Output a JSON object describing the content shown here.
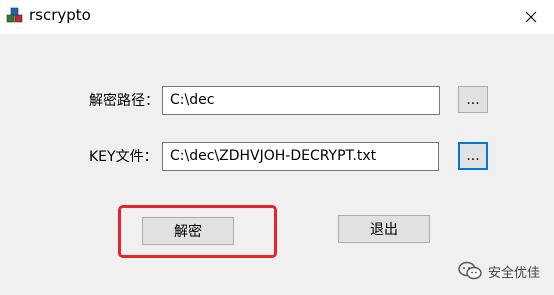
{
  "window": {
    "title": "rscrypto",
    "close_glyph": "✕"
  },
  "form": {
    "dec_path_label": "解密路径：",
    "dec_path_value": "C:\\dec",
    "browse_path_label": "...",
    "key_file_label": "KEY文件：",
    "key_file_value": "C:\\dec\\ZDHVJOH-DECRYPT.txt",
    "browse_key_label": "..."
  },
  "actions": {
    "decrypt_label": "解密",
    "exit_label": "退出"
  },
  "watermark": {
    "text": "安全优佳",
    "icon": "wechat-icon"
  },
  "colors": {
    "highlight": "#e8232a",
    "focus": "#0078d7"
  }
}
